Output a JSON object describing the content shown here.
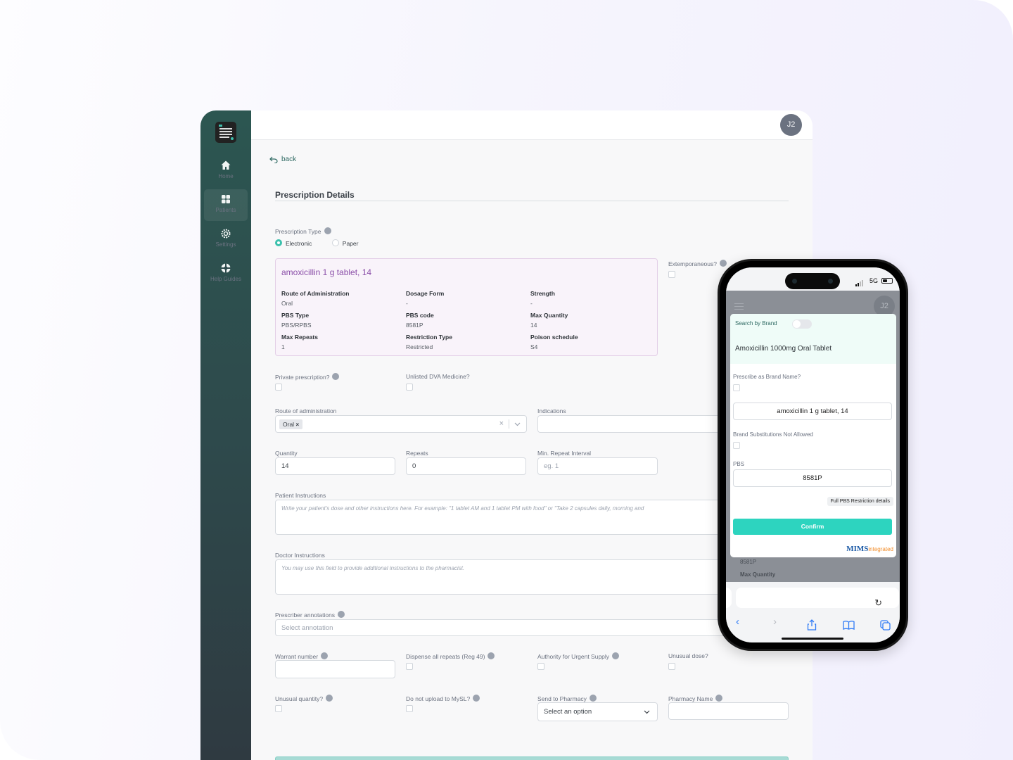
{
  "sidebar": {
    "logo": "prescription-logo",
    "items": [
      {
        "label": "Home",
        "icon": "home-icon",
        "active": false
      },
      {
        "label": "Patients",
        "icon": "grid-icon",
        "active": true
      },
      {
        "label": "Settings",
        "icon": "gear-icon",
        "active": false
      },
      {
        "label": "Help Guides",
        "icon": "lifebuoy-icon",
        "active": false
      }
    ]
  },
  "header": {
    "avatar_initials": "J2"
  },
  "page": {
    "back_label": "back",
    "title": "Prescription Details"
  },
  "form": {
    "prescription_type": {
      "label": "Prescription Type",
      "options": [
        "Electronic",
        "Paper"
      ],
      "selected": "Electronic"
    },
    "extemporaneous_label": "Extemporaneous?",
    "drug": {
      "name": "amoxicillin 1 g tablet, 14",
      "details": [
        {
          "key": "Route of Administration",
          "value": "Oral"
        },
        {
          "key": "Dosage Form",
          "value": "-"
        },
        {
          "key": "Strength",
          "value": "-"
        },
        {
          "key": "PBS Type",
          "value": "PBS/RPBS"
        },
        {
          "key": "PBS code",
          "value": "8581P"
        },
        {
          "key": "Max Quantity",
          "value": "14"
        },
        {
          "key": "Max Repeats",
          "value": "1"
        },
        {
          "key": "Restriction Type",
          "value": "Restricted"
        },
        {
          "key": "Poison schedule",
          "value": "S4"
        }
      ]
    },
    "private_prescription_label": "Private prescription?",
    "unlisted_dva_label": "Unlisted DVA Medicine?",
    "route_label": "Route of administration",
    "route_tag": "Oral",
    "indications_label": "Indications",
    "quantity_label": "Quantity",
    "quantity_value": "14",
    "repeats_label": "Repeats",
    "repeats_value": "0",
    "min_repeat_label": "Min. Repeat Interval",
    "min_repeat_placeholder": "eg. 1",
    "patient_instructions_label": "Patient Instructions",
    "patient_instructions_placeholder": "Write your patient's dose and other instructions here. For example: \"1 tablet AM and 1 tablet PM with food\" or \"Take 2 capsules daily, morning and",
    "doctor_instructions_label": "Doctor Instructions",
    "doctor_instructions_placeholder": "You may use this field to provide additional instructions to the pharmacist.",
    "annotations_label": "Prescriber annotations",
    "annotations_placeholder": "Select annotation",
    "warrant_label": "Warrant number",
    "dispense_all_label": "Dispense all repeats (Reg 49)",
    "urgent_supply_label": "Authority for Urgent Supply",
    "unusual_dose_label": "Unusual dose?",
    "unusual_quantity_label": "Unusual quantity?",
    "no_upload_label": "Do not upload to MySL?",
    "send_pharmacy_label": "Send to Pharmacy",
    "send_pharmacy_value": "Select an option",
    "pharmacy_name_label": "Pharmacy Name"
  },
  "phone": {
    "status": {
      "network": "5G"
    },
    "avatar_initials": "J2",
    "modal": {
      "search_by_brand_label": "Search by Brand",
      "search_by_brand_on": false,
      "product_name": "Amoxicillin 1000mg Oral Tablet",
      "brand_name_label": "Prescribe as Brand Name?",
      "drug_value": "amoxicillin 1 g tablet, 14",
      "brand_subs_label": "Brand Substitutions Not Allowed",
      "pbs_label": "PBS",
      "pbs_value": "8581P",
      "pbs_details_button": "Full PBS Restriction details",
      "confirm_button": "Confirm",
      "brand_logo": "MIMS",
      "brand_logo_suffix": "integrated"
    },
    "behind": {
      "pbs_code": "8581P",
      "max_quantity_label": "Max Quantity"
    }
  },
  "colors": {
    "accent": "#2dd4bf",
    "sidebar": "#2e4a4c",
    "drug_name": "#8b4fa8"
  }
}
